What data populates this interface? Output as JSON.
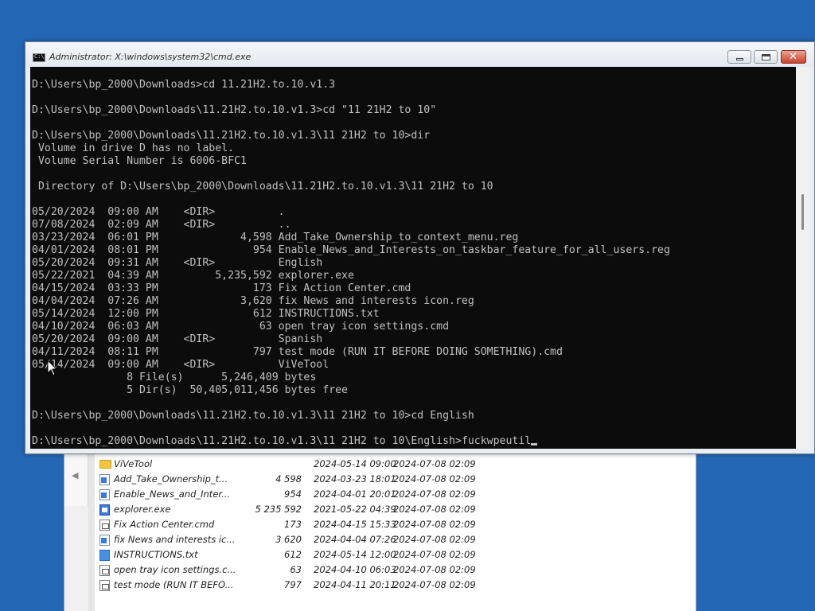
{
  "explorer": {
    "files": [
      {
        "name": "ViVeTool",
        "icon": "folder-icon",
        "size": "",
        "modified": "2024-05-14 09:00",
        "created": "2024-07-08 02:09"
      },
      {
        "name": "Add_Take_Ownership_t...",
        "icon": "reg-file-icon",
        "size": "4 598",
        "modified": "2024-03-23 18:01",
        "created": "2024-07-08 02:09"
      },
      {
        "name": "Enable_News_and_Inter...",
        "icon": "reg-file-icon",
        "size": "954",
        "modified": "2024-04-01 20:01",
        "created": "2024-07-08 02:09"
      },
      {
        "name": "explorer.exe",
        "icon": "exe-file-icon",
        "size": "5 235 592",
        "modified": "2021-05-22 04:39",
        "created": "2024-07-08 02:09"
      },
      {
        "name": "Fix Action Center.cmd",
        "icon": "cmd-file-icon",
        "size": "173",
        "modified": "2024-04-15 15:33",
        "created": "2024-07-08 02:09"
      },
      {
        "name": "fix News and interests ic...",
        "icon": "reg-file-icon",
        "size": "3 620",
        "modified": "2024-04-04 07:26",
        "created": "2024-07-08 02:09"
      },
      {
        "name": "INSTRUCTIONS.txt",
        "icon": "txt-file-icon",
        "size": "612",
        "modified": "2024-05-14 12:00",
        "created": "2024-07-08 02:09"
      },
      {
        "name": "open tray icon settings.c...",
        "icon": "cmd-file-icon",
        "size": "63",
        "modified": "2024-04-10 06:03",
        "created": "2024-07-08 02:09"
      },
      {
        "name": "test mode (RUN IT BEFO...",
        "icon": "cmd-file-icon",
        "size": "797",
        "modified": "2024-04-11 20:11",
        "created": "2024-07-08 02:09"
      }
    ]
  },
  "cmd": {
    "title": "Administrator: X:\\windows\\system32\\cmd.exe",
    "icon_label": "C:\\",
    "output": "D:\\Users\\bp_2000\\Downloads>cd 11.21H2.to.10.v1.3\n\nD:\\Users\\bp_2000\\Downloads\\11.21H2.to.10.v1.3>cd \"11 21H2 to 10\"\n\nD:\\Users\\bp_2000\\Downloads\\11.21H2.to.10.v1.3\\11 21H2 to 10>dir\n Volume in drive D has no label.\n Volume Serial Number is 6006-BFC1\n\n Directory of D:\\Users\\bp_2000\\Downloads\\11.21H2.to.10.v1.3\\11 21H2 to 10\n\n05/20/2024  09:00 AM    <DIR>          .\n07/08/2024  02:09 AM    <DIR>          ..\n03/23/2024  06:01 PM             4,598 Add_Take_Ownership_to_context_menu.reg\n04/01/2024  08:01 PM               954 Enable_News_and_Interests_on_taskbar_feature_for_all_users.reg\n05/20/2024  09:31 AM    <DIR>          English\n05/22/2021  04:39 AM         5,235,592 explorer.exe\n04/15/2024  03:33 PM               173 Fix Action Center.cmd\n04/04/2024  07:26 AM             3,620 fix News and interests icon.reg\n05/14/2024  12:00 PM               612 INSTRUCTIONS.txt\n04/10/2024  06:03 AM                63 open tray icon settings.cmd\n05/20/2024  09:00 AM    <DIR>          Spanish\n04/11/2024  08:11 PM               797 test mode (RUN IT BEFORE DOING SOMETHING).cmd\n05/14/2024  09:00 AM    <DIR>          ViVeTool\n               8 File(s)      5,246,409 bytes\n               5 Dir(s)  50,405,011,456 bytes free\n\nD:\\Users\\bp_2000\\Downloads\\11.21H2.to.10.v1.3\\11 21H2 to 10>cd English\n\nD:\\Users\\bp_2000\\Downloads\\11.21H2.to.10.v1.3\\11 21H2 to 10\\English>fuckwpeutil",
    "buttons": {
      "minimize": "minimize-icon",
      "maximize": "maximize-icon",
      "close": "close-icon",
      "close_glyph": "✕"
    }
  },
  "colors": {
    "desktop": "#2467b4",
    "console_bg": "#0c0c0c",
    "console_fg": "#c0c0c0",
    "close_button": "#c8432c"
  }
}
